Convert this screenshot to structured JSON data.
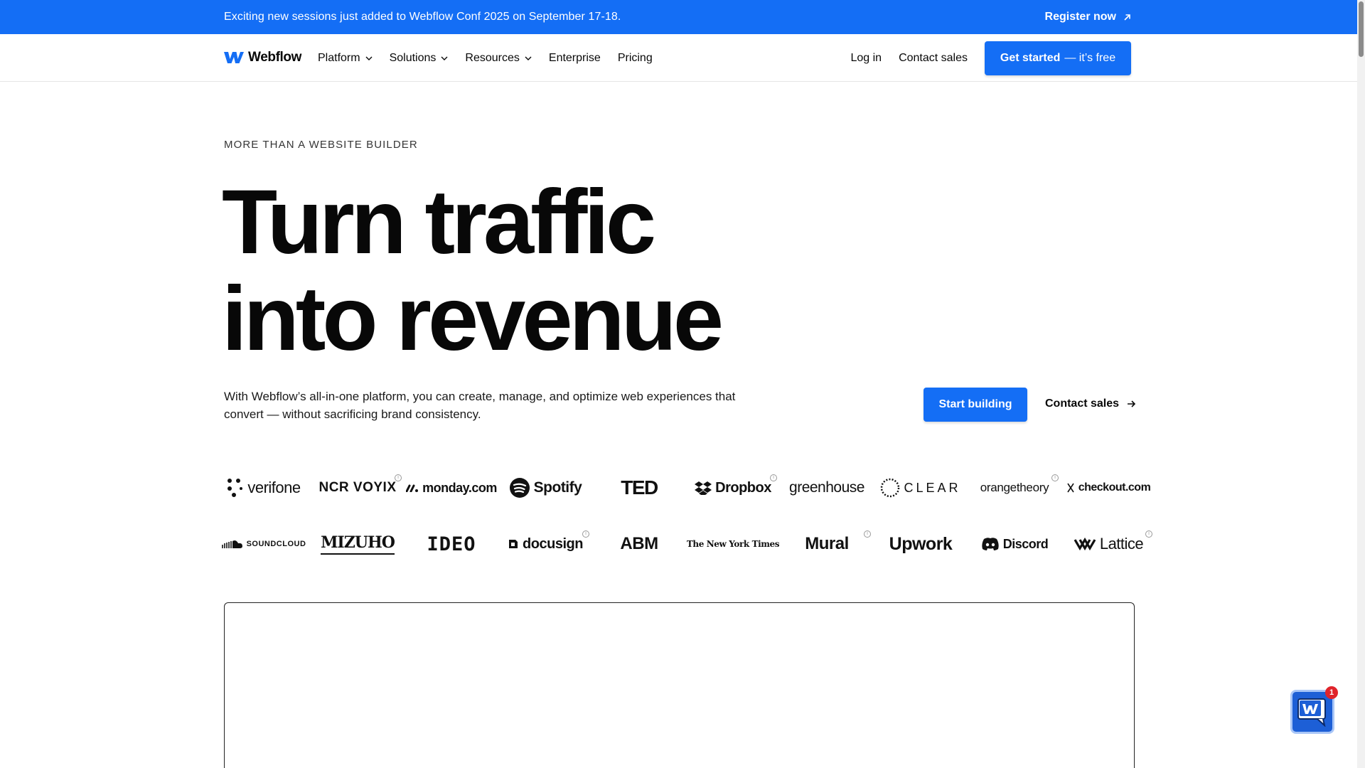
{
  "banner": {
    "text": "Exciting new sessions just added to Webflow Conf 2025 on September 17-18.",
    "link_label": "Register now"
  },
  "nav": {
    "brand": "Webflow",
    "items": [
      {
        "label": "Platform",
        "has_dropdown": true
      },
      {
        "label": "Solutions",
        "has_dropdown": true
      },
      {
        "label": "Resources",
        "has_dropdown": true
      },
      {
        "label": "Enterprise",
        "has_dropdown": false
      },
      {
        "label": "Pricing",
        "has_dropdown": false
      }
    ],
    "login": "Log in",
    "contact": "Contact sales",
    "cta_bold": "Get started",
    "cta_light": "— it’s free"
  },
  "hero": {
    "eyebrow": "MORE THAN A WEBSITE BUILDER",
    "headline_line1": "Turn traffic",
    "headline_line2": "into revenue",
    "subtext": "With Webflow’s all-in-one platform, you can create, manage, and optimize web experiences that convert — without sacrificing brand consistency.",
    "primary_cta": "Start building",
    "secondary_cta": "Contact sales"
  },
  "customer_logos": {
    "row1": [
      "verifone",
      "NCR VOYIX",
      "monday.com",
      "Spotify",
      "TED",
      "Dropbox",
      "greenhouse",
      "CLEAR",
      "orangetheory",
      "checkout.com"
    ],
    "row2": [
      "SOUNDCLOUD",
      "MIZUHO",
      "IDEO",
      "docusign",
      "ABM",
      "The New York Times",
      "Mural",
      "Upwork",
      "Discord",
      "Lattice"
    ]
  },
  "chat": {
    "badge_count": "1"
  },
  "colors": {
    "accent": "#146ef5",
    "text": "#080808",
    "badge": "#e0242b"
  }
}
